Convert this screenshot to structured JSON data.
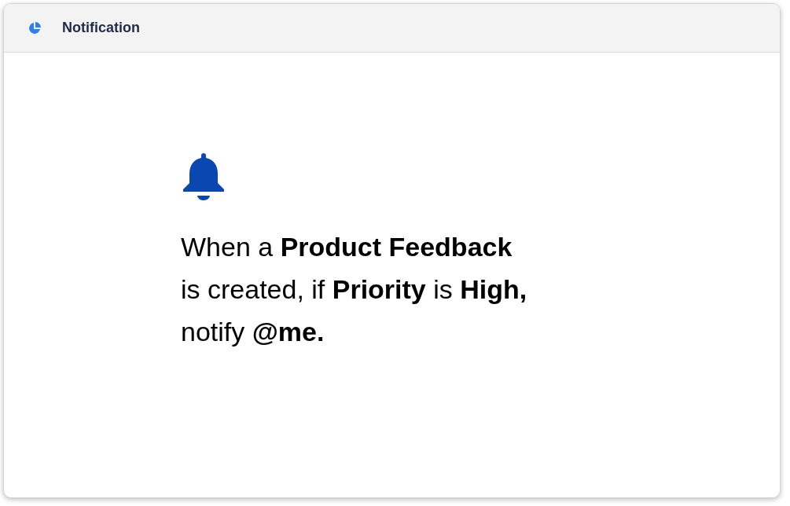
{
  "window": {
    "title": "Notification"
  },
  "message": {
    "lines": [
      "When a **Product Feedback**",
      "is created, if **Priority** is **High,**",
      "notify **@me.**"
    ]
  }
}
